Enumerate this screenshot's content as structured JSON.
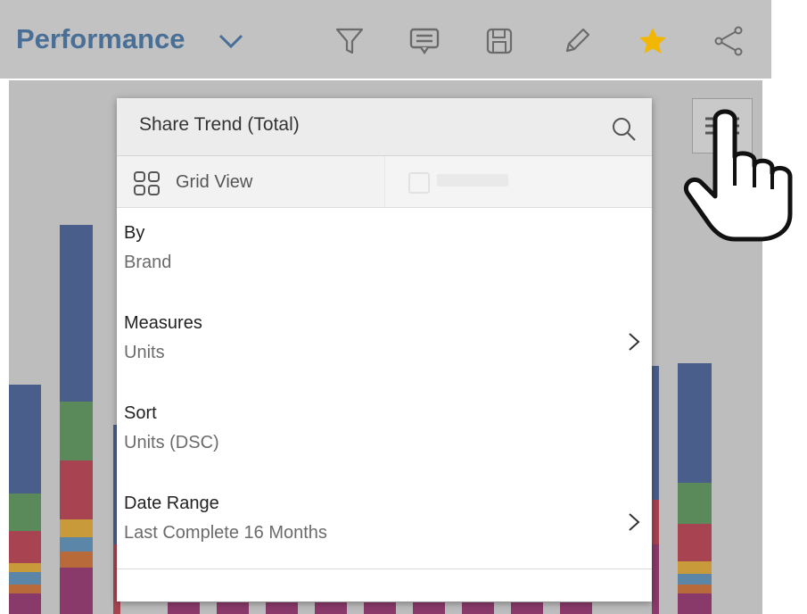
{
  "header": {
    "title": "Performance",
    "icons": [
      "chevron-down-icon",
      "filter-icon",
      "comment-icon",
      "save-icon",
      "pencil-icon",
      "star-icon",
      "share-icon"
    ],
    "accent_color": "#4a6f96",
    "star_color": "#f2b705"
  },
  "dropdown": {
    "title": "Share Trend (Total)",
    "search_icon": "search-icon",
    "view_tab_label": "Grid View",
    "items": [
      {
        "label": "By",
        "value": "Brand",
        "has_submenu": false
      },
      {
        "label": "Measures",
        "value": "Units",
        "has_submenu": true
      },
      {
        "label": "Sort",
        "value": "Units (DSC)",
        "has_submenu": false
      },
      {
        "label": "Date Range",
        "value": "Last Complete 16 Months",
        "has_submenu": true
      }
    ]
  },
  "background_chart": {
    "type": "stacked-bar",
    "colors": [
      "#4a5e8c",
      "#5a8a5a",
      "#a84452",
      "#c89a3a",
      "#5b86a8",
      "#b86a3a",
      "#8a3a6a"
    ]
  }
}
